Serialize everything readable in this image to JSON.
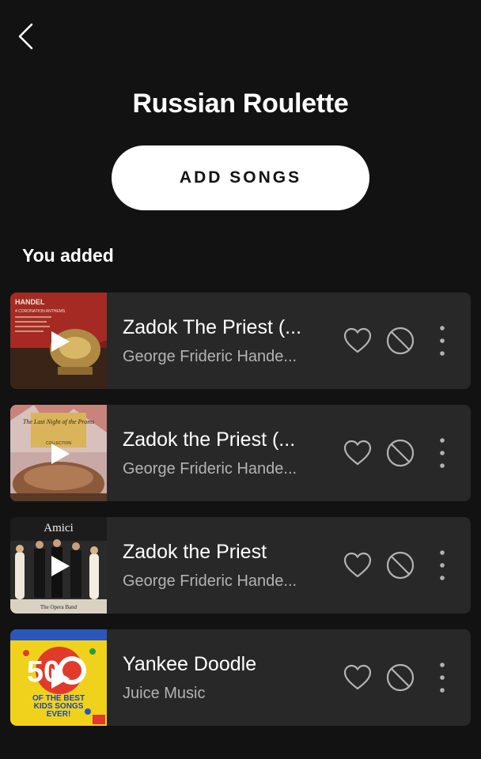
{
  "header": {
    "back_icon": "chevron-left-icon",
    "title": "Russian Roulette"
  },
  "actions": {
    "add_songs_label": "ADD SONGS"
  },
  "section": {
    "label": "You added"
  },
  "tracks": [
    {
      "title": "Zadok The Priest (...",
      "artist": "George Frideric Hande...",
      "cover_text": [
        "HANDEL",
        "4 CORONATION ANTHEMS"
      ]
    },
    {
      "title": "Zadok the Priest (...",
      "artist": "George Frideric Hande...",
      "cover_text": [
        "The Last Night of the Proms",
        "COLLECTION"
      ]
    },
    {
      "title": "Zadok the Priest",
      "artist": "George Frideric Hande...",
      "cover_text": [
        "Amici",
        "The Opera Band"
      ]
    },
    {
      "title": "Yankee Doodle",
      "artist": "Juice Music",
      "cover_text": [
        "50",
        "OF THE BEST",
        "KIDS SONGS",
        "EVER!"
      ]
    }
  ],
  "icons": {
    "play": "play-icon",
    "like": "heart-icon",
    "hide": "block-icon",
    "more": "more-vertical-icon"
  },
  "colors": {
    "background": "#121212",
    "row": "#282828",
    "text_primary": "#ffffff",
    "text_secondary": "#b3b3b3",
    "button": "#ffffff"
  }
}
